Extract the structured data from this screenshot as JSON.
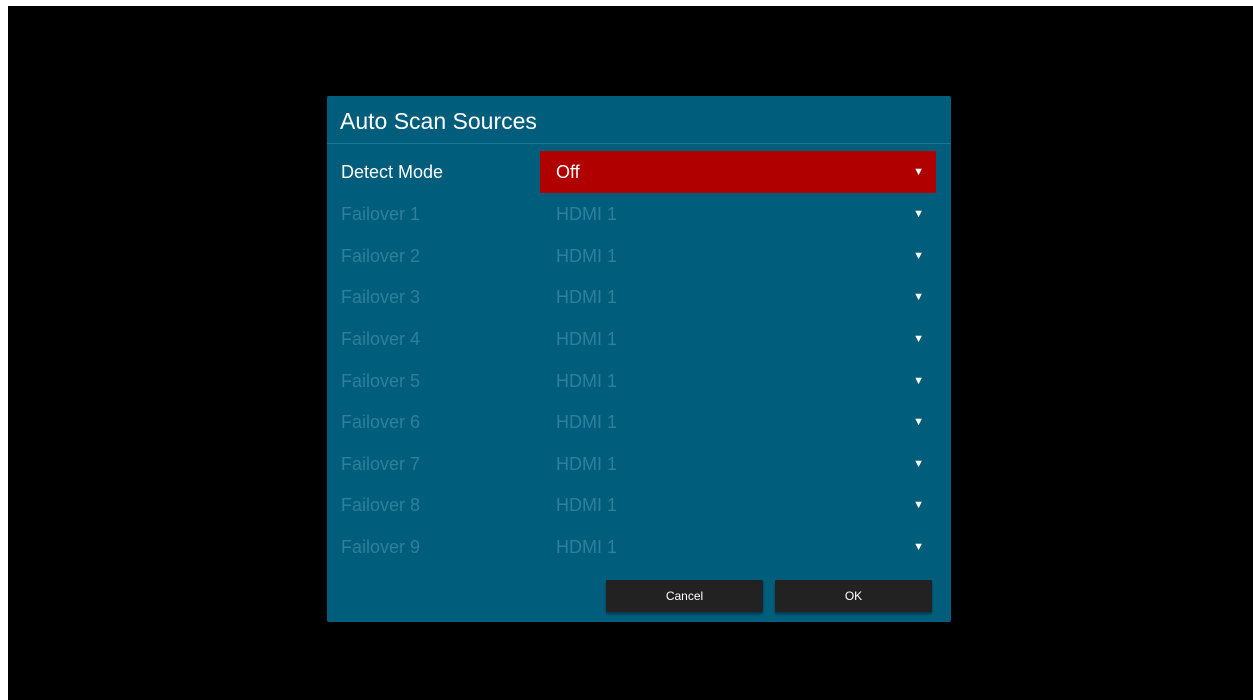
{
  "dialog": {
    "title": "Auto Scan Sources"
  },
  "detect_mode": {
    "label": "Detect Mode",
    "value": "Off"
  },
  "failovers": [
    {
      "label": "Failover 1",
      "value": "HDMI 1"
    },
    {
      "label": "Failover 2",
      "value": "HDMI 1"
    },
    {
      "label": "Failover 3",
      "value": "HDMI 1"
    },
    {
      "label": "Failover 4",
      "value": "HDMI 1"
    },
    {
      "label": "Failover 5",
      "value": "HDMI 1"
    },
    {
      "label": "Failover 6",
      "value": "HDMI 1"
    },
    {
      "label": "Failover 7",
      "value": "HDMI 1"
    },
    {
      "label": "Failover 8",
      "value": "HDMI 1"
    },
    {
      "label": "Failover 9",
      "value": "HDMI 1"
    }
  ],
  "buttons": {
    "cancel_label": "Cancel",
    "ok_label": "OK"
  },
  "icons": {
    "dropdown": "dropdown-arrow-icon"
  },
  "colors": {
    "screen_background": "#000000",
    "dialog_background": "#015d7c",
    "selected_highlight": "#b00000",
    "disabled_text": "#2e7f9b",
    "button_background": "#222222"
  }
}
